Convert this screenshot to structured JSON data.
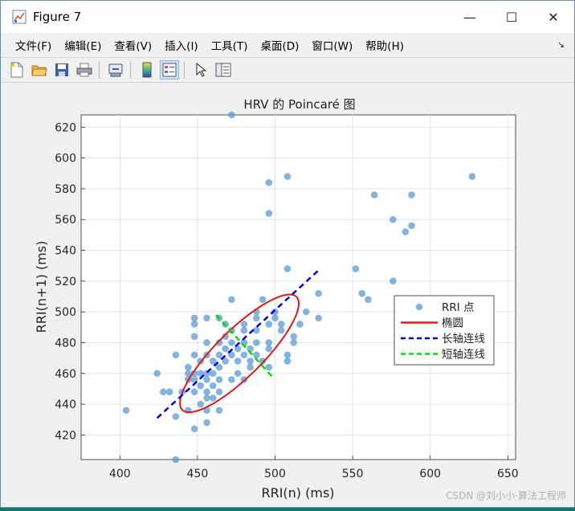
{
  "window": {
    "title": "Figure 7",
    "controls": {
      "minimize": "—",
      "maximize": "☐",
      "close": "✕"
    }
  },
  "menu": {
    "items": [
      "文件(F)",
      "编辑(E)",
      "查看(V)",
      "插入(I)",
      "工具(T)",
      "桌面(D)",
      "窗口(W)",
      "帮助(H)"
    ],
    "pin": "↘"
  },
  "toolbar": {
    "tools": [
      "new-file-icon",
      "open-folder-icon",
      "save-icon",
      "print-icon",
      "export-icon",
      "colorbar-icon",
      "legend-icon",
      "pointer-icon",
      "property-editor-icon"
    ]
  },
  "watermark": "CSDN @刘小小·算法工程师",
  "colors": {
    "points": "#5b9bd1",
    "ellipse": "#e01818",
    "major_axis": "#0000e0",
    "minor_axis": "#00e000"
  },
  "chart_data": {
    "type": "scatter",
    "title": "HRV 的 Poincaré 图",
    "xlabel": "RRI(n) (ms)",
    "ylabel": "RRI(n+1) (ms)",
    "xlim": [
      375,
      655
    ],
    "ylim": [
      404,
      628
    ],
    "xticks": [
      400,
      450,
      500,
      550,
      600,
      650
    ],
    "yticks": [
      420,
      440,
      460,
      480,
      500,
      520,
      540,
      560,
      580,
      600,
      620
    ],
    "grid": true,
    "legend_position": "right",
    "legend": [
      "RRI 点",
      "椭圆",
      "长轴连线",
      "短轴连线"
    ],
    "series": [
      {
        "name": "RRI 点",
        "points": [
          [
            472,
            628
          ],
          [
            508,
            588
          ],
          [
            627,
            588
          ],
          [
            496,
            584
          ],
          [
            564,
            576
          ],
          [
            588,
            576
          ],
          [
            496,
            564
          ],
          [
            576,
            560
          ],
          [
            588,
            556
          ],
          [
            584,
            552
          ],
          [
            508,
            528
          ],
          [
            552,
            528
          ],
          [
            576,
            520
          ],
          [
            528,
            512
          ],
          [
            556,
            512
          ],
          [
            560,
            508
          ],
          [
            472,
            508
          ],
          [
            492,
            508
          ],
          [
            520,
            500
          ],
          [
            488,
            500
          ],
          [
            500,
            500
          ],
          [
            448,
            496
          ],
          [
            456,
            496
          ],
          [
            464,
            496
          ],
          [
            488,
            496
          ],
          [
            500,
            496
          ],
          [
            528,
            496
          ],
          [
            448,
            492
          ],
          [
            468,
            492
          ],
          [
            480,
            492
          ],
          [
            496,
            492
          ],
          [
            504,
            492
          ],
          [
            516,
            492
          ],
          [
            448,
            484
          ],
          [
            468,
            484
          ],
          [
            472,
            488
          ],
          [
            480,
            488
          ],
          [
            488,
            488
          ],
          [
            504,
            488
          ],
          [
            512,
            484
          ],
          [
            456,
            480
          ],
          [
            464,
            480
          ],
          [
            472,
            480
          ],
          [
            480,
            480
          ],
          [
            488,
            480
          ],
          [
            496,
            480
          ],
          [
            512,
            480
          ],
          [
            468,
            476
          ],
          [
            476,
            476
          ],
          [
            484,
            476
          ],
          [
            496,
            476
          ],
          [
            436,
            472
          ],
          [
            448,
            472
          ],
          [
            456,
            472
          ],
          [
            464,
            472
          ],
          [
            472,
            472
          ],
          [
            480,
            472
          ],
          [
            488,
            472
          ],
          [
            508,
            472
          ],
          [
            444,
            464
          ],
          [
            452,
            468
          ],
          [
            460,
            468
          ],
          [
            468,
            468
          ],
          [
            476,
            468
          ],
          [
            484,
            468
          ],
          [
            492,
            468
          ],
          [
            496,
            464
          ],
          [
            508,
            468
          ],
          [
            424,
            460
          ],
          [
            444,
            460
          ],
          [
            448,
            460
          ],
          [
            452,
            460
          ],
          [
            456,
            460
          ],
          [
            460,
            460
          ],
          [
            464,
            464
          ],
          [
            476,
            460
          ],
          [
            484,
            464
          ],
          [
            444,
            456
          ],
          [
            448,
            456
          ],
          [
            456,
            456
          ],
          [
            464,
            456
          ],
          [
            472,
            456
          ],
          [
            480,
            456
          ],
          [
            452,
            452
          ],
          [
            460,
            452
          ],
          [
            428,
            448
          ],
          [
            432,
            448
          ],
          [
            440,
            448
          ],
          [
            448,
            448
          ],
          [
            456,
            448
          ],
          [
            464,
            448
          ],
          [
            456,
            444
          ],
          [
            460,
            444
          ],
          [
            452,
            440
          ],
          [
            444,
            436
          ],
          [
            456,
            436
          ],
          [
            464,
            436
          ],
          [
            404,
            436
          ],
          [
            436,
            432
          ],
          [
            456,
            428
          ],
          [
            448,
            424
          ],
          [
            436,
            404
          ]
        ]
      }
    ],
    "ellipse": {
      "center": [
        477,
        473
      ],
      "semi_major": 52,
      "semi_minor": 15,
      "angle_deg": 45
    },
    "major_axis_line": [
      [
        424,
        431
      ],
      [
        528,
        527
      ]
    ],
    "minor_axis_line": [
      [
        462,
        498
      ],
      [
        498,
        458
      ]
    ]
  }
}
